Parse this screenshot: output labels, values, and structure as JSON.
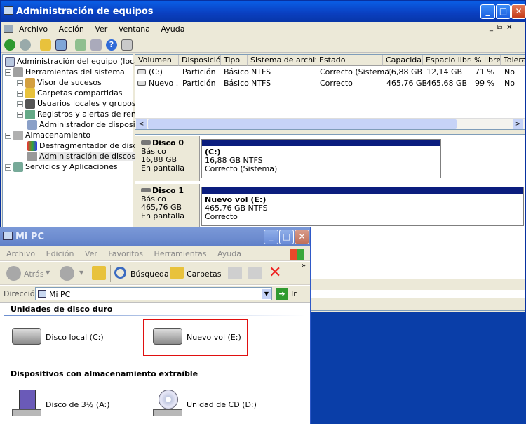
{
  "mmc": {
    "title": "Administración de equipos",
    "menu": [
      "Archivo",
      "Acción",
      "Ver",
      "Ventana",
      "Ayuda"
    ],
    "tree": {
      "root": "Administración del equipo (local)",
      "items": [
        {
          "label": "Herramientas del sistema",
          "level": 1,
          "exp": "−"
        },
        {
          "label": "Visor de sucesos",
          "level": 2,
          "exp": "+"
        },
        {
          "label": "Carpetas compartidas",
          "level": 2,
          "exp": "+"
        },
        {
          "label": "Usuarios locales y grupos",
          "level": 2,
          "exp": "+"
        },
        {
          "label": "Registros y alertas de rendim",
          "level": 2,
          "exp": "+"
        },
        {
          "label": "Administrador de dispositivos",
          "level": 2,
          "exp": ""
        },
        {
          "label": "Almacenamiento",
          "level": 1,
          "exp": "−"
        },
        {
          "label": "Desfragmentador de disco",
          "level": 2,
          "exp": ""
        },
        {
          "label": "Administración de discos",
          "level": 2,
          "exp": ""
        },
        {
          "label": "Servicios y Aplicaciones",
          "level": 1,
          "exp": "+"
        }
      ]
    },
    "table": {
      "headers": [
        "Volumen",
        "Disposición",
        "Tipo",
        "Sistema de archivos",
        "Estado",
        "Capacidad",
        "Espacio libre",
        "% libre",
        "Toleran"
      ],
      "rows": [
        [
          "(C:)",
          "Partición",
          "Básico",
          "NTFS",
          "Correcto (Sistema)",
          "16,88 GB",
          "12,14 GB",
          "71 %",
          "No"
        ],
        [
          "Nuevo ...",
          "Partición",
          "Básico",
          "NTFS",
          "Correcto",
          "465,76 GB",
          "465,68 GB",
          "99 %",
          "No"
        ]
      ]
    },
    "disks": [
      {
        "name": "Disco 0",
        "type": "Básico",
        "size": "16,88 GB",
        "state": "En pantalla",
        "vol_name": "(C:)",
        "vol_size": "16,88 GB NTFS",
        "vol_state": "Correcto (Sistema)"
      },
      {
        "name": "Disco 1",
        "type": "Básico",
        "size": "465,76 GB",
        "state": "En pantalla",
        "vol_name": "Nuevo vol  (E:)",
        "vol_size": "465,76 GB NTFS",
        "vol_state": "Correcto"
      }
    ]
  },
  "mypc": {
    "title": "Mi PC",
    "menu": [
      "Archivo",
      "Edición",
      "Ver",
      "Favoritos",
      "Herramientas",
      "Ayuda"
    ],
    "back": "Atrás",
    "search": "Búsqueda",
    "folders": "Carpetas",
    "address_label": "Dirección",
    "address": "Mi PC",
    "go": "Ir",
    "section1": "Unidades de disco duro",
    "drive_c": "Disco local (C:)",
    "drive_e": "Nuevo vol (E:)",
    "section2": "Dispositivos con almacenamiento extraíble",
    "floppy": "Disco de 3½ (A:)",
    "cd": "Unidad de CD (D:)"
  }
}
